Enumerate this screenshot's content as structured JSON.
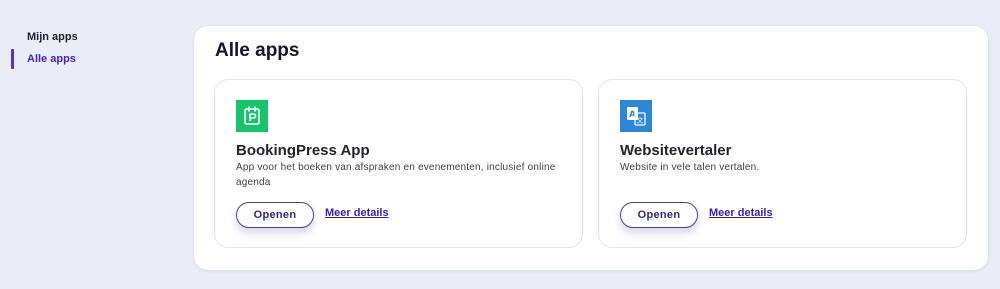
{
  "sidebar": {
    "items": [
      {
        "label": "Mijn apps",
        "active": false
      },
      {
        "label": "Alle apps",
        "active": true
      }
    ]
  },
  "main": {
    "title": "Alle apps",
    "apps": [
      {
        "name": "BookingPress App",
        "description": "App voor het boeken van afspraken en evenementen, inclusief online agenda",
        "icon": "booking-calendar-icon",
        "icon_color": "#19c36e",
        "open_label": "Openen",
        "details_label": "Meer details"
      },
      {
        "name": "Websitevertaler",
        "description": "Website in vele talen vertalen.",
        "icon": "translate-icon",
        "icon_color": "#2e86d6",
        "open_label": "Openen",
        "details_label": "Meer details"
      }
    ]
  },
  "colors": {
    "background": "#e9edf5",
    "accent": "#5b2fd0",
    "link": "#3a1ea6"
  }
}
